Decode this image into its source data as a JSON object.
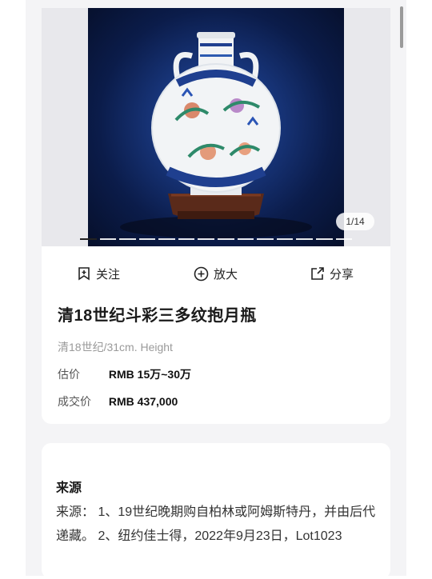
{
  "gallery": {
    "counter": "1/14",
    "total_pages": 14,
    "current_page": 1
  },
  "actions": {
    "follow_label": "关注",
    "zoom_label": "放大",
    "share_label": "分享"
  },
  "lot": {
    "title": "清18世纪斗彩三多纹抱月瓶",
    "subtitle": "清18世纪/31cm. Height",
    "estimate_label": "估价",
    "estimate_value": "RMB 15万~30万",
    "sold_label": "成交价",
    "sold_value": "RMB 437,000"
  },
  "provenance": {
    "heading": "来源",
    "body": "来源： 1、19世纪晚期购自柏林或阿姆斯特丹，并由后代递藏。 2、纽约佳士得，2022年9月23日，Lot1023"
  },
  "colors": {
    "photo_background": "#0b1c4a",
    "vase_body": "#f2f4f6",
    "cobalt": "#1f3f8f",
    "stand": "#5a2a1a"
  }
}
